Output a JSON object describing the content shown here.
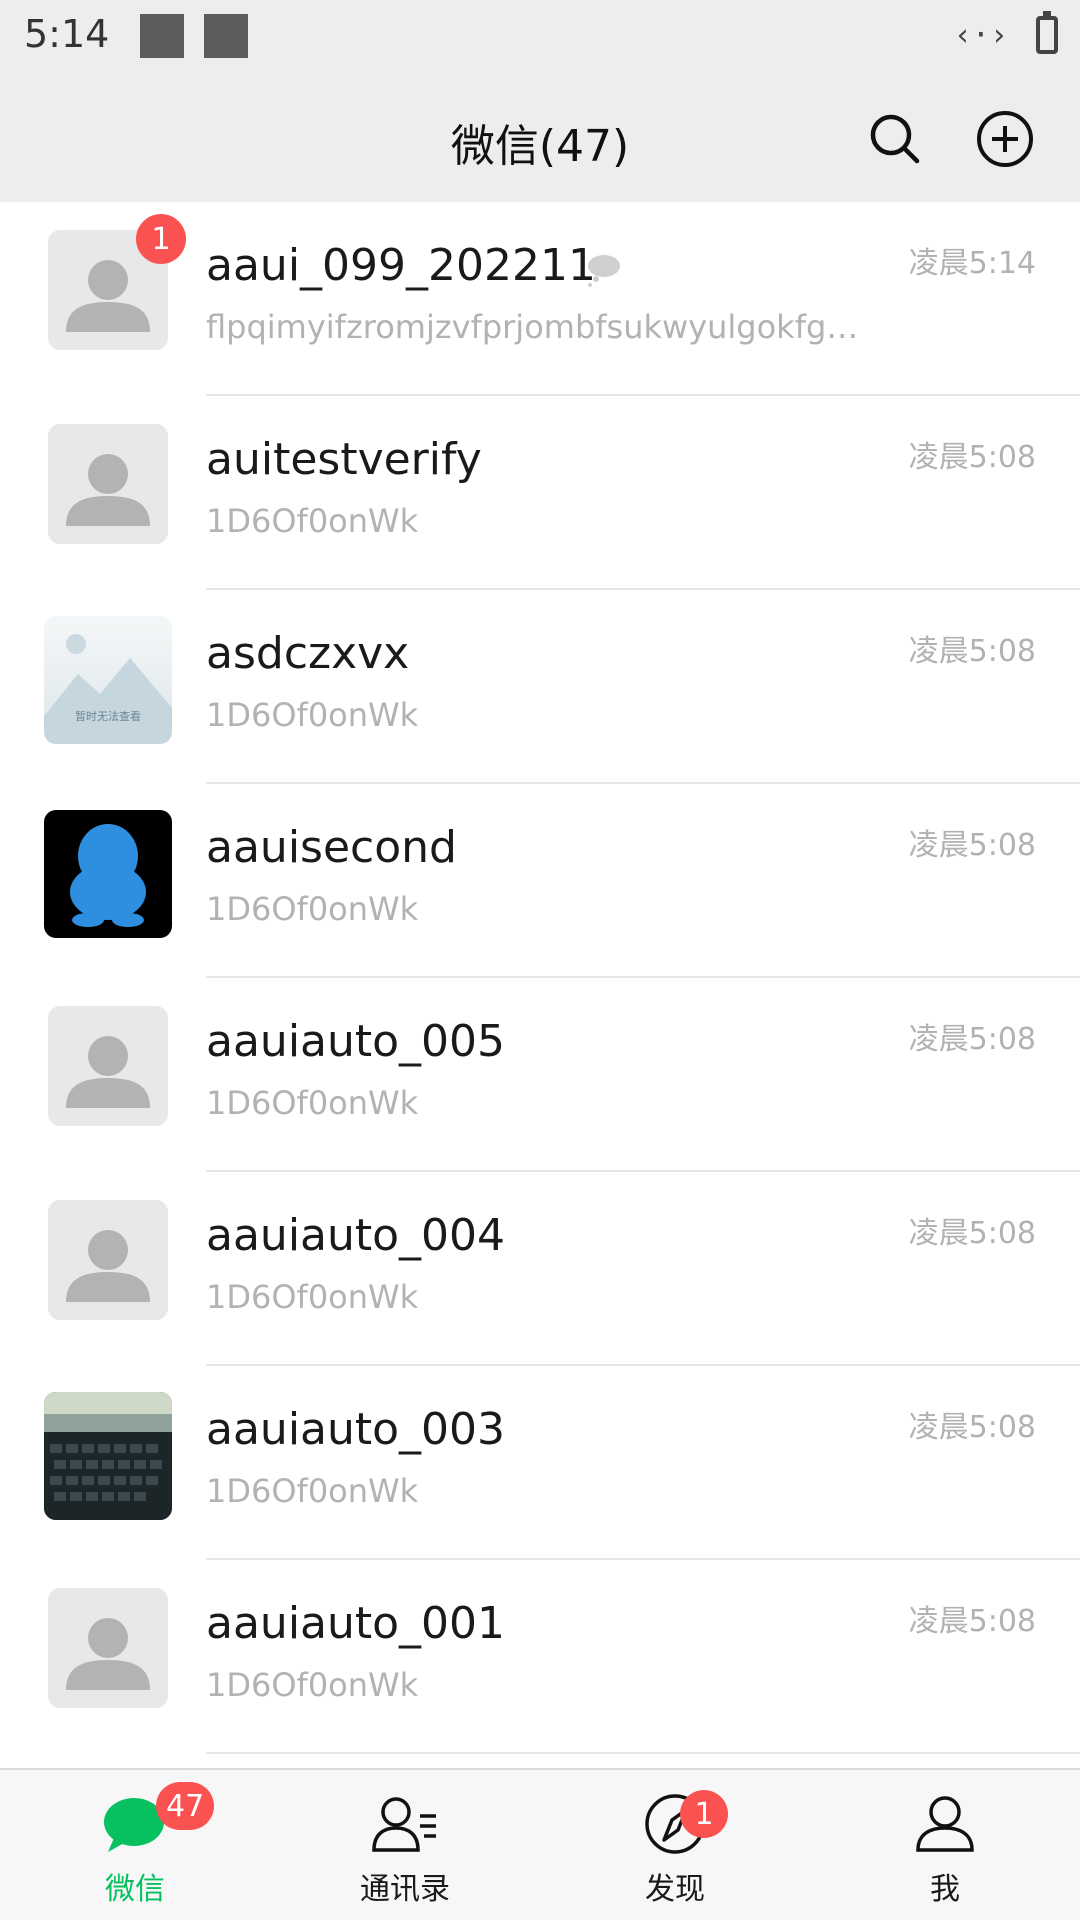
{
  "status_bar": {
    "time": "5:14",
    "network_symbol": "‹·›"
  },
  "header": {
    "title": "微信(47)"
  },
  "chats": [
    {
      "name": "aaui_099_202211",
      "preview": "flpqimyifzromjzvfprjombfsukwyulgokfgbi…",
      "time": "凌晨5:14",
      "unread": "1",
      "avatar": "default-avatar",
      "muted": true
    },
    {
      "name": "auitestverify",
      "preview": "1D6Of0onWk",
      "time": "凌晨5:08",
      "avatar": "default-avatar"
    },
    {
      "name": "asdczxvx",
      "preview": "1D6Of0onWk",
      "time": "凌晨5:08",
      "avatar": "image-unavailable",
      "avatar_text": "暂时无法查看"
    },
    {
      "name": "aauisecond",
      "preview": "1D6Of0onWk",
      "time": "凌晨5:08",
      "avatar": "penguin-avatar"
    },
    {
      "name": "aauiauto_005",
      "preview": "1D6Of0onWk",
      "time": "凌晨5:08",
      "avatar": "default-avatar"
    },
    {
      "name": "aauiauto_004",
      "preview": "1D6Of0onWk",
      "time": "凌晨5:08",
      "avatar": "default-avatar"
    },
    {
      "name": "aauiauto_003",
      "preview": "1D6Of0onWk",
      "time": "凌晨5:08",
      "avatar": "keyboard-photo"
    },
    {
      "name": "aauiauto_001",
      "preview": "1D6Of0onWk",
      "time": "凌晨5:08",
      "avatar": "default-avatar"
    }
  ],
  "tabs": [
    {
      "label": "微信",
      "icon": "chat-bubble-icon",
      "badge": "47",
      "active": true
    },
    {
      "label": "通讯录",
      "icon": "contacts-icon"
    },
    {
      "label": "发现",
      "icon": "compass-icon",
      "badge": "1"
    },
    {
      "label": "我",
      "icon": "profile-icon"
    }
  ],
  "colors": {
    "accent": "#07c160",
    "badge": "#fa5151",
    "header_bg": "#ededed",
    "secondary_text": "#b2b2b2"
  }
}
